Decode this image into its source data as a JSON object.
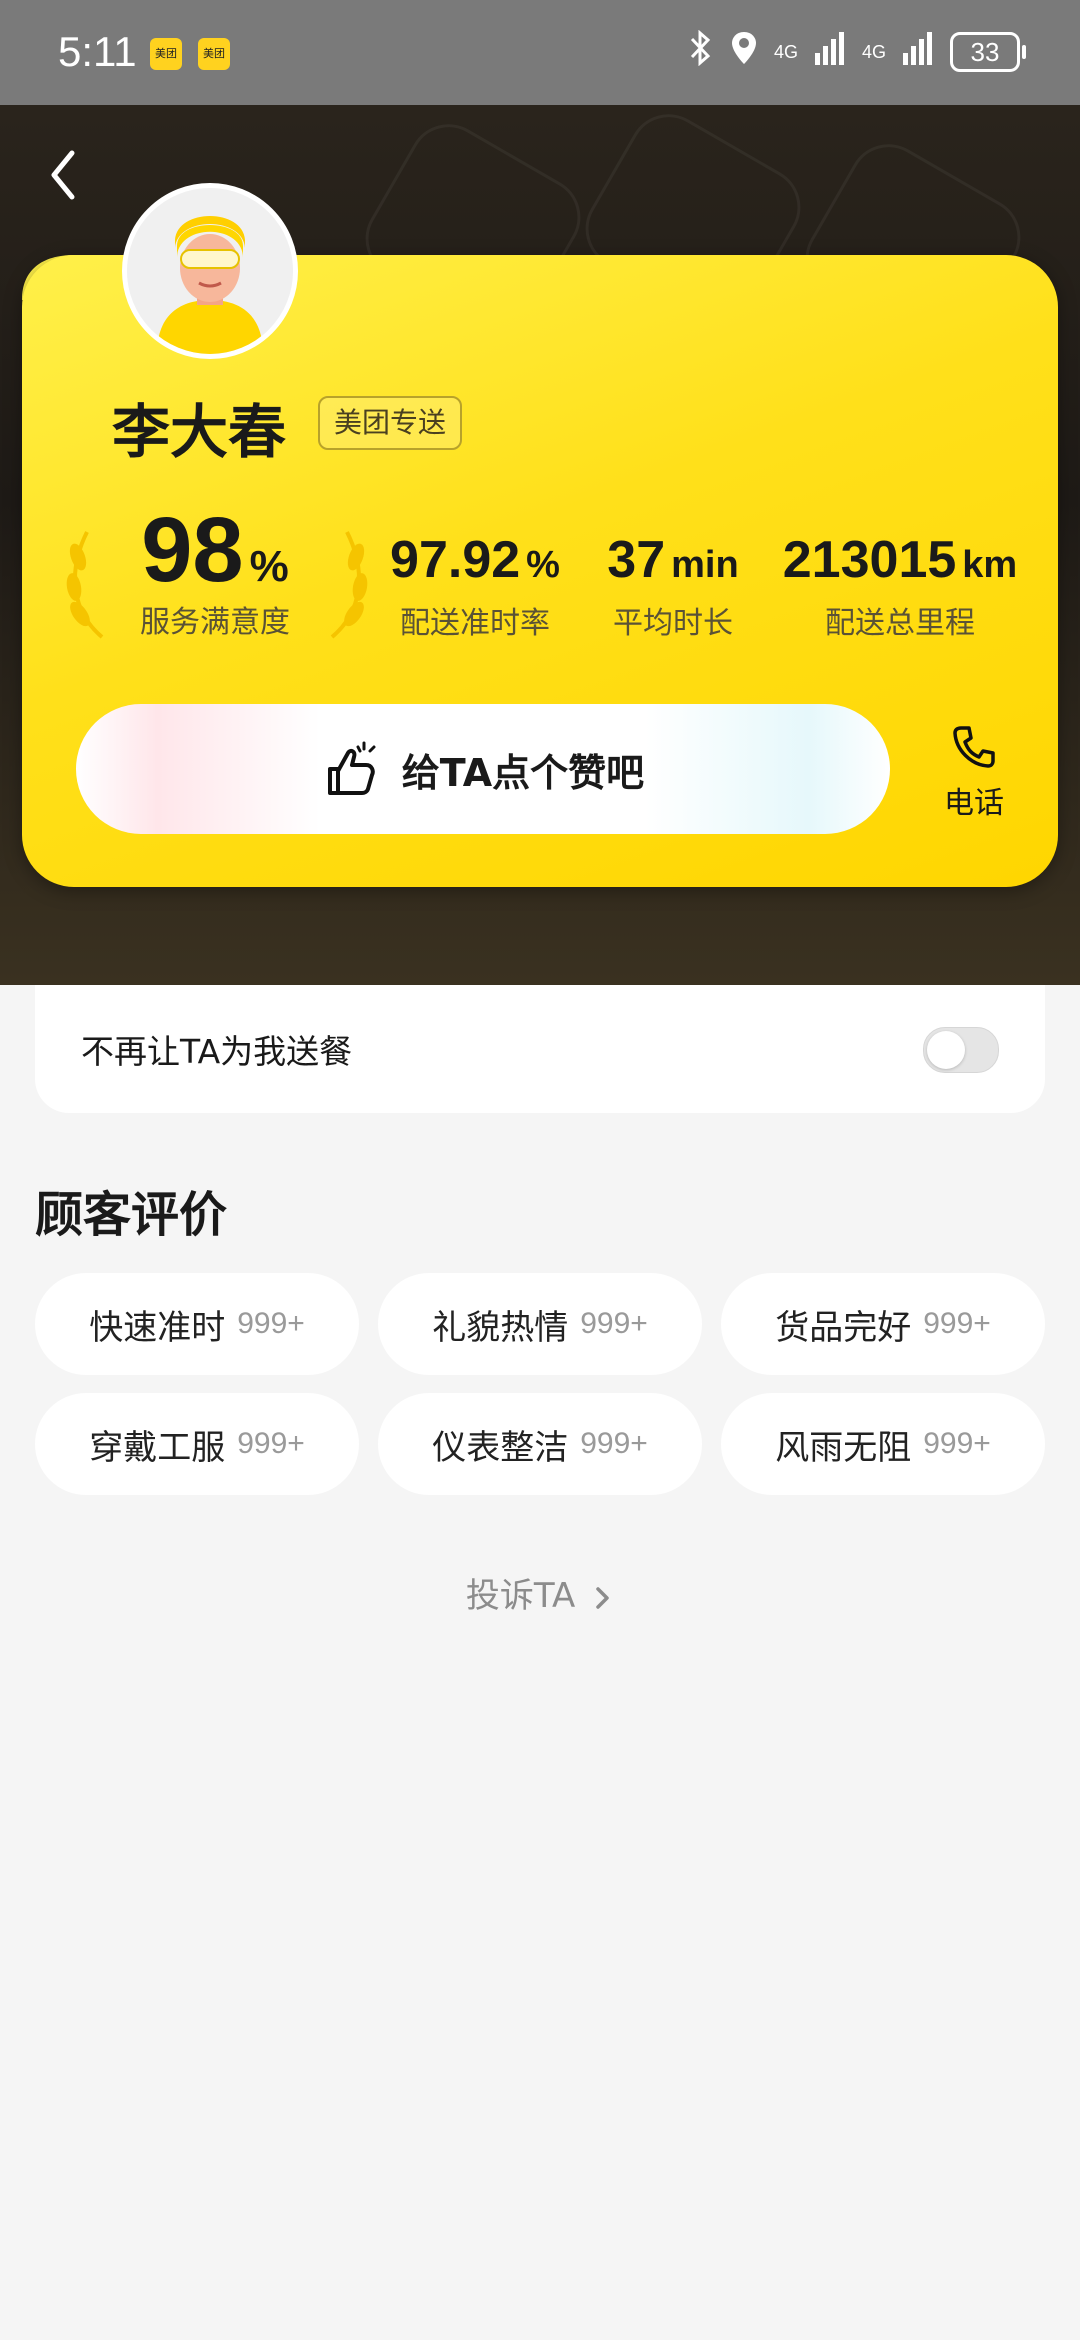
{
  "status_bar": {
    "time": "5:11",
    "badge1": "美团",
    "badge2": "美团",
    "signal1": "4G",
    "signal2": "4G",
    "battery": "33"
  },
  "rider": {
    "name": "李大春",
    "tag": "美团专送"
  },
  "stats": [
    {
      "value": "98",
      "unit": "%",
      "label": "服务满意度"
    },
    {
      "value": "97.92",
      "unit": "%",
      "label": "配送准时率"
    },
    {
      "value": "37",
      "unit": "min",
      "label": "平均时长"
    },
    {
      "value": "213015",
      "unit": "km",
      "label": "配送总里程"
    }
  ],
  "actions": {
    "like": "给TA点个赞吧",
    "phone": "电话"
  },
  "block": {
    "label": "不再让TA为我送餐",
    "enabled": false
  },
  "reviews": {
    "title": "顾客评价",
    "items": [
      {
        "label": "快速准时",
        "count": "999+"
      },
      {
        "label": "礼貌热情",
        "count": "999+"
      },
      {
        "label": "货品完好",
        "count": "999+"
      },
      {
        "label": "穿戴工服",
        "count": "999+"
      },
      {
        "label": "仪表整洁",
        "count": "999+"
      },
      {
        "label": "风雨无阻",
        "count": "999+"
      }
    ]
  },
  "complain": "投诉TA",
  "colors": {
    "accent_yellow": "#ffd600",
    "hero_dark": "#1e1a16",
    "background": "#f5f5f5"
  }
}
